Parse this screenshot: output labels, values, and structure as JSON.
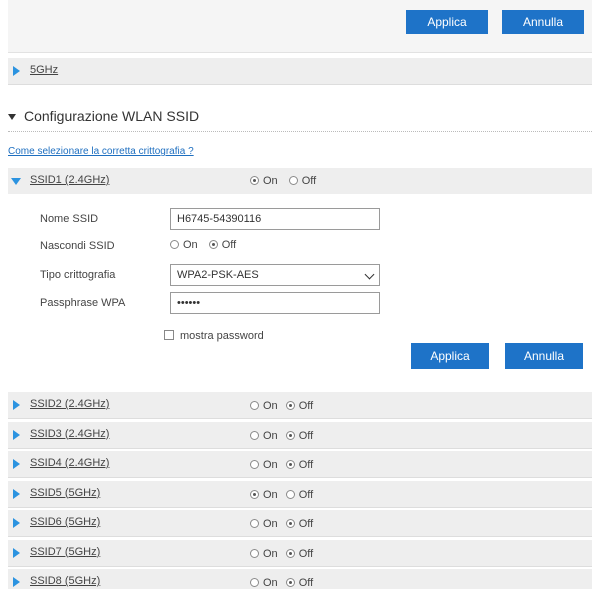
{
  "top": {
    "apply_label": "Applica",
    "cancel_label": "Annulla"
  },
  "band_5ghz": {
    "label": "5GHz"
  },
  "section": {
    "title": "Configurazione WLAN SSID",
    "help_link": "Come selezionare la corretta crittografia ?"
  },
  "radio_labels": {
    "on": "On",
    "off": "Off"
  },
  "ssid1": {
    "label": "SSID1 (2.4GHz)",
    "enabled": "On",
    "fields": {
      "name_label": "Nome SSID",
      "name_value": "H6745-54390116",
      "hide_label": "Nascondi SSID",
      "hide_value": "Off",
      "enc_label": "Tipo crittografia",
      "enc_value": "WPA2-PSK-AES",
      "pass_label": "Passphrase WPA",
      "pass_value": "••••••",
      "show_password_label": "mostra password"
    },
    "apply_label": "Applica",
    "cancel_label": "Annulla"
  },
  "ssids": [
    {
      "label": "SSID2 (2.4GHz)",
      "state": "Off"
    },
    {
      "label": "SSID3 (2.4GHz)",
      "state": "Off"
    },
    {
      "label": "SSID4 (2.4GHz)",
      "state": "Off"
    },
    {
      "label": "SSID5 (5GHz)",
      "state": "On"
    },
    {
      "label": "SSID6 (5GHz)",
      "state": "Off"
    },
    {
      "label": "SSID7 (5GHz)",
      "state": "Off"
    },
    {
      "label": "SSID8 (5GHz)",
      "state": "Off"
    }
  ],
  "colors": {
    "button_blue": "#1e73c8",
    "triangle_blue": "#2b93e0",
    "row_bg": "#eeeeee",
    "link_blue": "#1e6fc0"
  }
}
